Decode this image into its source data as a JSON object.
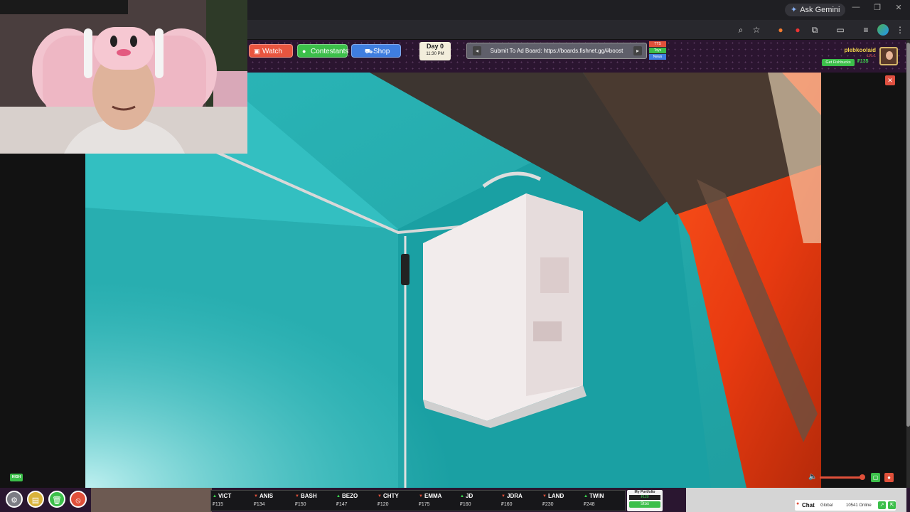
{
  "browser": {
    "gemini_label": "Ask Gemini",
    "window_controls": [
      "—",
      "❐",
      "✕"
    ]
  },
  "nav": {
    "watch_label": "Watch",
    "contestants_label": "Contestants",
    "shop_label": "Shop"
  },
  "day": {
    "label": "Day 0",
    "time": "11:30 PM"
  },
  "ad_board": {
    "text": "Submit To Ad Board: https://boards.fishnet.gg/#boost"
  },
  "tags": [
    "TTS",
    "Toys",
    "News"
  ],
  "user": {
    "name": "plebkoolaid",
    "level": "LVL 1",
    "fishbucks_button": "Get Fishbucks",
    "balance": "₣135"
  },
  "stream": {
    "quality": "HIGH",
    "volume_percent": 95
  },
  "ticker": [
    {
      "symbol": "VICT",
      "price": "₣115",
      "dir": "up"
    },
    {
      "symbol": "ANIS",
      "price": "₣134",
      "dir": "down"
    },
    {
      "symbol": "BASH",
      "price": "₣150",
      "dir": "down"
    },
    {
      "symbol": "BEZO",
      "price": "₣147",
      "dir": "up"
    },
    {
      "symbol": "CHTY",
      "price": "₣120",
      "dir": "down"
    },
    {
      "symbol": "EMMA",
      "price": "₣175",
      "dir": "down"
    },
    {
      "symbol": "JD",
      "price": "₣160",
      "dir": "up"
    },
    {
      "symbol": "JDRA",
      "price": "₣160",
      "dir": "down"
    },
    {
      "symbol": "LAND",
      "price": "₣230",
      "dir": "down"
    },
    {
      "symbol": "TWIN",
      "price": "₣248",
      "dir": "up"
    }
  ],
  "portfolio": {
    "label": "My Portfolio",
    "value": "₣120",
    "button": "Stox"
  },
  "chat": {
    "label": "Chat",
    "scope": "Global",
    "online": "10541 Online"
  },
  "colors": {
    "watch": "#e8553f",
    "contestants": "#3cbf4a",
    "shop": "#3f7ee0",
    "accent_green": "#3cd94f",
    "header_bg": "#2b1530"
  }
}
